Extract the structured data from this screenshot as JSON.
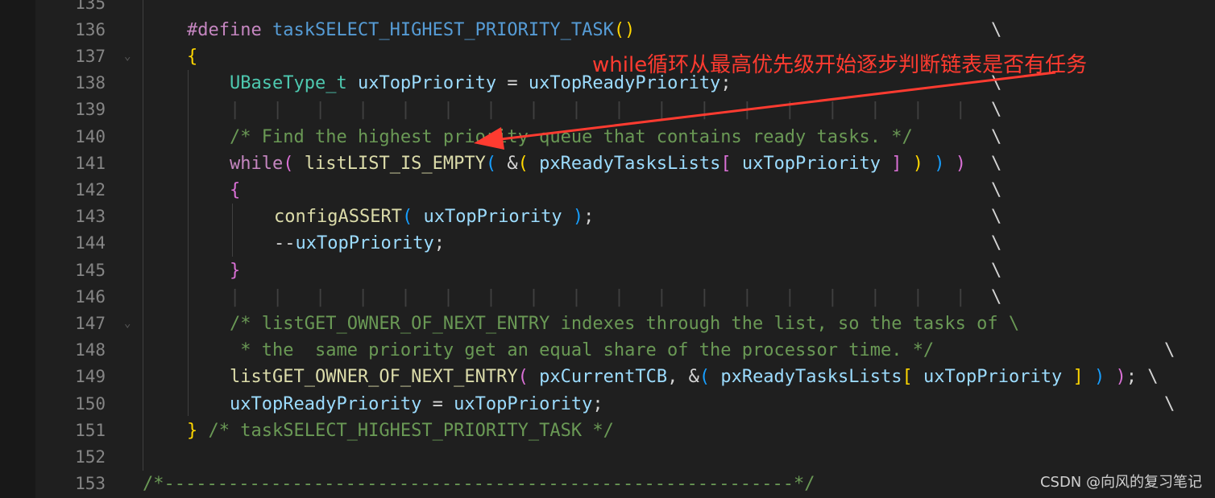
{
  "editor": {
    "line_numbers": [
      "135",
      "136",
      "137",
      "138",
      "139",
      "140",
      "141",
      "142",
      "143",
      "144",
      "145",
      "146",
      "147",
      "148",
      "149",
      "150",
      "151",
      "152",
      "153"
    ],
    "lines": {
      "l136_pp": "#define",
      "l136_macro": "taskSELECT_HIGHEST_PRIORITY_TASK",
      "l137_brace": "{",
      "l138_type": "UBaseType_t",
      "l138_var": "uxTopPriority",
      "l138_eq": " = ",
      "l138_val": "uxTopReadyPriority",
      "l138_end": ";",
      "l140_comment": "/* Find the highest priority queue that contains ready tasks. */",
      "l141_kw": "while",
      "l141_fn": "listLIST_IS_EMPTY",
      "l141_amp": "&",
      "l141_arr": "pxReadyTasksLists",
      "l141_idx": "uxTopPriority",
      "l142_brace": "{",
      "l143_fn": "configASSERT",
      "l143_arg": "uxTopPriority",
      "l143_end": ";",
      "l144_op": "--",
      "l144_var": "uxTopPriority",
      "l144_end": ";",
      "l145_brace": "}",
      "l147_comment": "/* listGET_OWNER_OF_NEXT_ENTRY indexes through the list, so the tasks of \\",
      "l148_comment": " * the  same priority get an equal share of the processor time. */",
      "l149_fn": "listGET_OWNER_OF_NEXT_ENTRY",
      "l149_arg1": "pxCurrentTCB",
      "l149_amp": "&",
      "l149_arr": "pxReadyTasksLists",
      "l149_idx": "uxTopPriority",
      "l149_end": ";",
      "l150_var": "uxTopReadyPriority",
      "l150_eq": " = ",
      "l150_val": "uxTopPriority",
      "l150_end": ";",
      "l151_brace": "}",
      "l151_comment": "/* taskSELECT_HIGHEST_PRIORITY_TASK */",
      "l153_comment": "/*-----------------------------------------------------------*/",
      "backslash": "\\"
    }
  },
  "annotation": {
    "text": "while循环从最高优先级开始逐步判断链表是否有任务",
    "color": "#ff3b30"
  },
  "watermark": "CSDN @向风的复习笔记",
  "colors": {
    "background": "#1f1f1f",
    "line_number": "#858585",
    "comment": "#6a9955",
    "macro": "#569cd6",
    "function": "#dcdcaa",
    "type": "#4ec9b0",
    "variable": "#9cdcfe",
    "keyword": "#c586c0"
  }
}
